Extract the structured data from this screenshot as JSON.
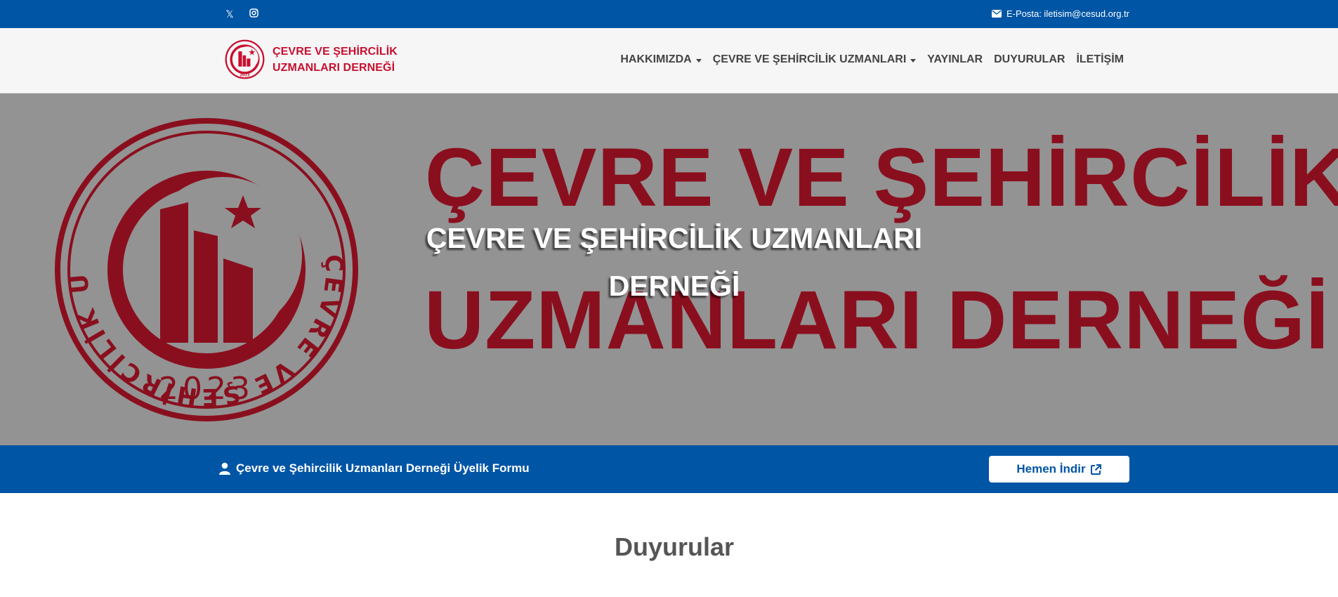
{
  "topbar": {
    "social": [
      {
        "icon": "x-twitter-icon",
        "glyph": "𝕏"
      },
      {
        "icon": "instagram-icon",
        "glyph": "◎"
      }
    ],
    "email_text": "E-Posta: iletisim@cesud.org.tr"
  },
  "header": {
    "brand_line1": "ÇEVRE VE ŞEHİRCİLİK",
    "brand_line2": "UZMANLARI DERNEĞİ",
    "nav": [
      {
        "label": "HAKKIMIZDA",
        "dropdown": true
      },
      {
        "label": "ÇEVRE VE ŞEHİRCİLİK UZMANLARI",
        "dropdown": true
      },
      {
        "label": "YAYINLAR",
        "dropdown": false
      },
      {
        "label": "DUYURULAR",
        "dropdown": false
      },
      {
        "label": "İLETİŞİM",
        "dropdown": false
      }
    ]
  },
  "hero": {
    "banner_line1": "ÇEVRE VE ŞEHİRCİLİK",
    "banner_line2": "UZMANLARI DERNEĞİ",
    "seal_text_top": "ÇEVRE VE ŞEHİRCİLİK UZMANLARI DERNEĞİ",
    "seal_year": "2023",
    "title_line1": "ÇEVRE VE ŞEHİRCİLİK UZMANLARI",
    "title_line2": "DERNEĞİ"
  },
  "membership": {
    "label": "Çevre ve Şehircilik Uzmanları Derneği Üyelik Formu",
    "button_label": "Hemen İndir"
  },
  "announcements": {
    "title": "Duyurular"
  },
  "colors": {
    "primary_blue": "#0055a5",
    "brand_red": "#c8102e",
    "banner_red": "#8a0f1e",
    "hero_gray": "#939393"
  }
}
